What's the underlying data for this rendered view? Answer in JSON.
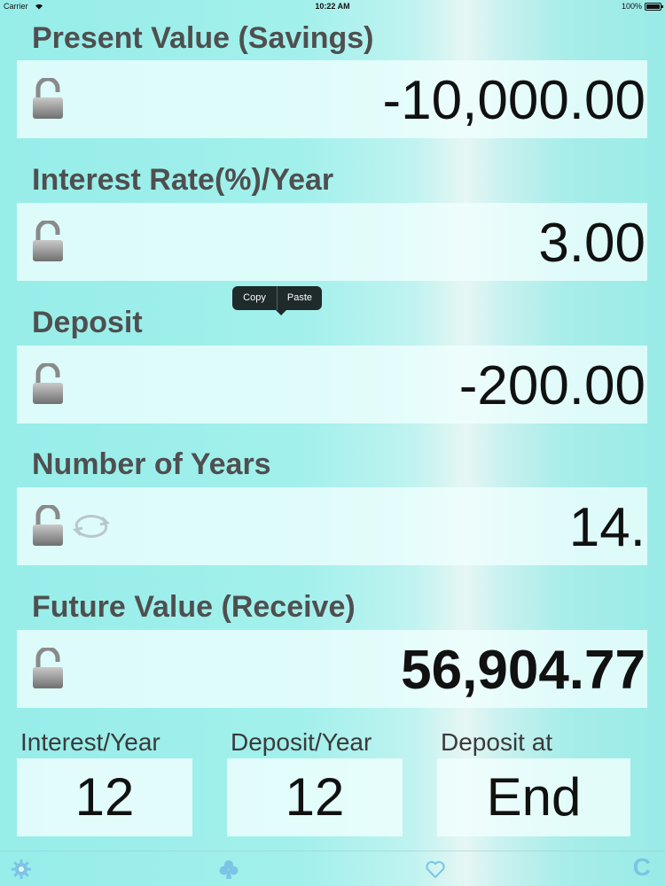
{
  "status": {
    "carrier": "Carrier",
    "time": "10:22 AM",
    "battery": "100%"
  },
  "fields": [
    {
      "label": "Present Value (Savings)",
      "value": "-10,000.00"
    },
    {
      "label": "Interest Rate(%)/Year",
      "value": "3.00"
    },
    {
      "label": "Deposit",
      "value": "-200.00"
    },
    {
      "label": "Number of Years",
      "value": "14."
    },
    {
      "label": "Future Value (Receive)",
      "value": "56,904.77"
    }
  ],
  "popover": {
    "copy": "Copy",
    "paste": "Paste"
  },
  "options": [
    {
      "label": "Interest/Year",
      "value": "12"
    },
    {
      "label": "Deposit/Year",
      "value": "12"
    },
    {
      "label": "Deposit at",
      "value": "End"
    }
  ],
  "tabbar": {
    "icons": [
      "gear-icon",
      "club-icon",
      "heart-icon"
    ],
    "clear_label": "C",
    "accent": "#7cc4e6"
  },
  "colors": {
    "label": "#4f4f4f",
    "value": "#111111",
    "popover": "#1f2a2b"
  }
}
